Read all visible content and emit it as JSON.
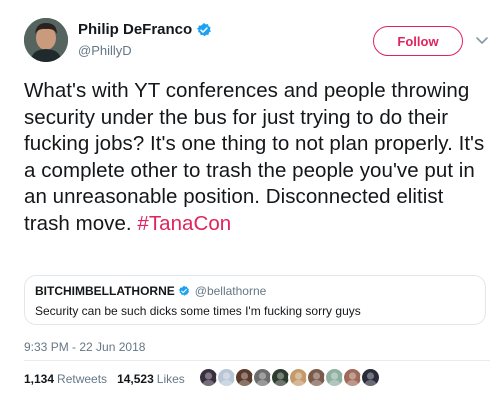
{
  "author": {
    "display_name": "Philip DeFranco",
    "handle": "@PhillyD",
    "verified": true
  },
  "follow_label": "Follow",
  "tweet": {
    "text": "What's with YT conferences and people throwing security under the bus for just trying to do their fucking jobs? It's one thing to not plan properly. It's a complete other to trash the people you've put in an unreasonable position. Disconnected elitist trash move. ",
    "hashtag": "#TanaCon"
  },
  "quote": {
    "name": "BITCHIMBELLATHORNE",
    "handle": "@bellathorne",
    "text": "Security can be such dicks some times I'm fucking sorry guys"
  },
  "timestamp": "9:33 PM - 22 Jun 2018",
  "stats": {
    "retweets_count": "1,134",
    "retweets_label": "Retweets",
    "likes_count": "14,523",
    "likes_label": "Likes"
  },
  "liker_avatars": [
    "#3a2f3f",
    "#b8c7d6",
    "#5a3a2a",
    "#6d6d6d",
    "#2e3b2f",
    "#c59a6a",
    "#7a5a4a",
    "#8fb0a0",
    "#a06a5a",
    "#2a2a3a"
  ],
  "colors": {
    "accent": "#e0245e",
    "verified_blue": "#1da1f2",
    "secondary_text": "#657786"
  }
}
